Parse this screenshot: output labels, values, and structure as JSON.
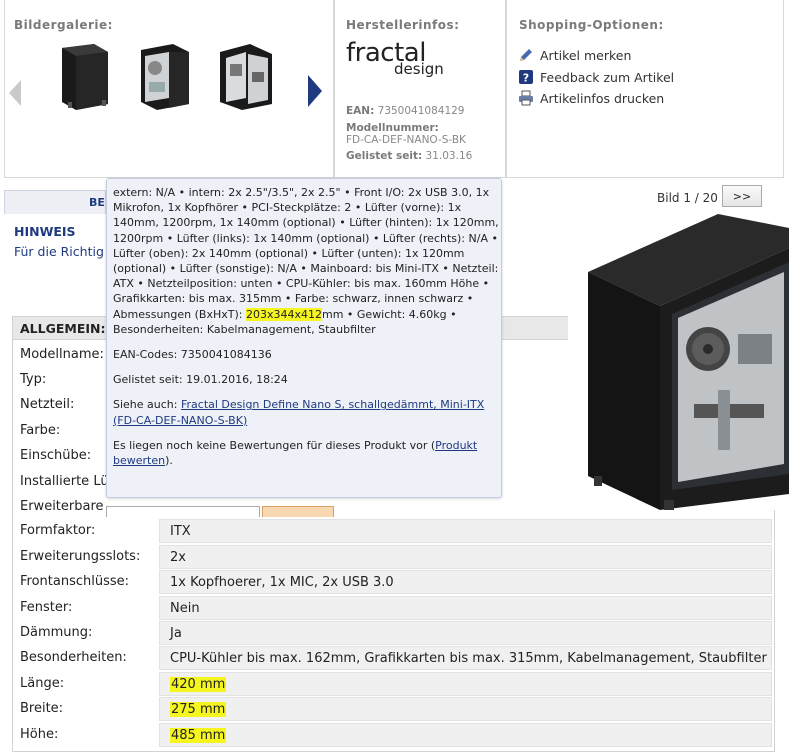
{
  "gallery": {
    "title": "Bildergalerie:"
  },
  "manufacturer": {
    "title": "Herstellerinfos:",
    "logo_text_top": "fractal",
    "logo_text_bottom": "design",
    "ean_label": "EAN:",
    "ean_value": "7350041084129",
    "model_label": "Modellnummer:",
    "model_value": "FD-CA-DEF-NANO-S-BK",
    "listed_label": "Gelistet seit:",
    "listed_value": "31.03.16"
  },
  "shopping": {
    "title": "Shopping-Optionen:",
    "items": [
      {
        "label": "Artikel merken",
        "icon": "pencil-icon"
      },
      {
        "label": "Feedback zum Artikel",
        "icon": "question-icon"
      },
      {
        "label": "Artikelinfos drucken",
        "icon": "printer-icon"
      }
    ]
  },
  "tab": {
    "label": "BE"
  },
  "pager": {
    "text": "Bild 1 / 20",
    "next": ">>"
  },
  "hinweis": {
    "title": "HINWEIS",
    "text": "Für die Richtig"
  },
  "tooltip": {
    "specs_before_hl": "extern: N/A • intern: 2x 2.5\"/3.5\", 2x 2.5\" • Front I/O: 2x USB 3.0, 1x Mikrofon, 1x Kopfhörer • PCI-Steckplätze: 2 • Lüfter (vorne): 1x 140mm, 1200rpm, 1x 140mm (optional) • Lüfter (hinten): 1x 120mm, 1200rpm • Lüfter (links): 1x 140mm (optional) • Lüfter (rechts): N/A • Lüfter (oben): 2x 140mm (optional) • Lüfter (unten): 1x 120mm (optional) • Lüfter (sonstige): N/A • Mainboard: bis Mini-ITX • Netzteil: ATX • Netzteilposition: unten • CPU-Kühler: bis max. 160mm Höhe • Grafikkarten: bis max. 315mm • Farbe: schwarz, innen schwarz • Abmessungen (BxHxT): ",
    "specs_hl": "203x344x412",
    "specs_after_hl": "mm • Gewicht: 4.60kg • Besonderheiten: Kabelmanagement, Staubfilter",
    "ean": "EAN-Codes: 7350041084136",
    "listed": "Gelistet seit: 19.01.2016, 18:24",
    "see_also_label": "Siehe auch: ",
    "see_also_link": "Fractal Design Define Nano S, schallgedämmt, Mini-ITX (FD-CA-DEF-NANO-S-BK)",
    "reviews_prefix": "Es liegen noch keine Bewertungen für dieses Produkt vor (",
    "reviews_link": "Produkt bewerten",
    "reviews_suffix": ")."
  },
  "spec_table": {
    "header": "ALLGEMEIN:",
    "rows_hidden": [
      {
        "label": "Modellname:"
      },
      {
        "label": "Typ:"
      },
      {
        "label": "Netzteil:"
      },
      {
        "label": "Farbe:"
      },
      {
        "label": "Einschübe:"
      },
      {
        "label": "Installierte Lü"
      },
      {
        "label": "Erweiterbare"
      }
    ],
    "rows": [
      {
        "label": "Formfaktor:",
        "value": "ITX"
      },
      {
        "label": "Erweiterungsslots:",
        "value": "2x"
      },
      {
        "label": "Frontanschlüsse:",
        "value": "1x Kopfhoerer, 1x MIC, 2x USB 3.0"
      },
      {
        "label": "Fenster:",
        "value": "Nein"
      },
      {
        "label": "Dämmung:",
        "value": "Ja"
      },
      {
        "label": "Besonderheiten:",
        "value": "CPU-Kühler bis max. 162mm, Grafikkarten bis max. 315mm, Kabelmanagement, Staubfilter"
      },
      {
        "label": "Länge:",
        "value": "420 mm"
      },
      {
        "label": "Breite:",
        "value": "275 mm"
      },
      {
        "label": "Höhe:",
        "value": "485 mm"
      }
    ]
  },
  "colors": {
    "brand_blue": "#1f3a80",
    "highlight": "#f5f51f"
  }
}
